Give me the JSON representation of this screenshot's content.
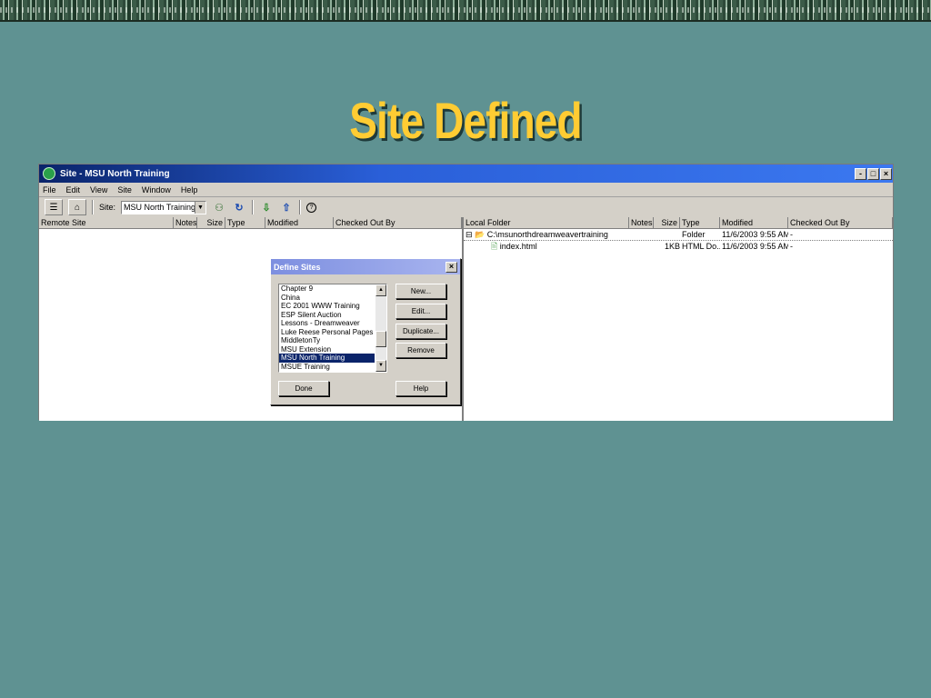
{
  "slide": {
    "title": "Site Defined"
  },
  "window": {
    "title": "Site - MSU North Training",
    "controls": {
      "minimize": "-",
      "maximize": "□",
      "close": "×"
    }
  },
  "menubar": {
    "items": [
      "File",
      "Edit",
      "View",
      "Site",
      "Window",
      "Help"
    ]
  },
  "toolbar": {
    "site_label": "Site:",
    "site_value": "MSU North Training",
    "help_icon_glyph": "?"
  },
  "remote_pane": {
    "columns": [
      "Remote Site",
      "Notes",
      "Size",
      "Type",
      "Modified",
      "Checked Out By"
    ]
  },
  "local_pane": {
    "columns": [
      "Local Folder",
      "Notes",
      "Size",
      "Type",
      "Modified",
      "Checked Out By"
    ],
    "rows": [
      {
        "name": "C:\\msunorthdreamweavertraining",
        "notes": "",
        "size": "",
        "type": "Folder",
        "modified": "11/6/2003 9:55 AM",
        "checked_out_by": "-",
        "icon": "folder-icon",
        "expand": "⊟"
      },
      {
        "name": "index.html",
        "notes": "",
        "size": "1KB",
        "type": "HTML Do...",
        "modified": "11/6/2003 9:55 AM",
        "checked_out_by": "-",
        "icon": "html-file-icon"
      }
    ]
  },
  "define_sites_dialog": {
    "title": "Define Sites",
    "close": "×",
    "sites": [
      "Chapter 9",
      "China",
      "EC 2001 WWW Training",
      "ESP Silent Auction",
      "Lessons - Dreamweaver",
      "Luke Reese Personal Pages",
      "MiddletonTy",
      "MSU Extension",
      "MSU North Training",
      "MSUE Training"
    ],
    "selected_site": "MSU North Training",
    "buttons": {
      "new": "New...",
      "edit": "Edit...",
      "duplicate": "Duplicate...",
      "remove": "Remove",
      "done": "Done",
      "help": "Help"
    }
  },
  "colors": {
    "background": "#5f9292",
    "title": "#ffcc33",
    "selection": "#0a246a"
  }
}
